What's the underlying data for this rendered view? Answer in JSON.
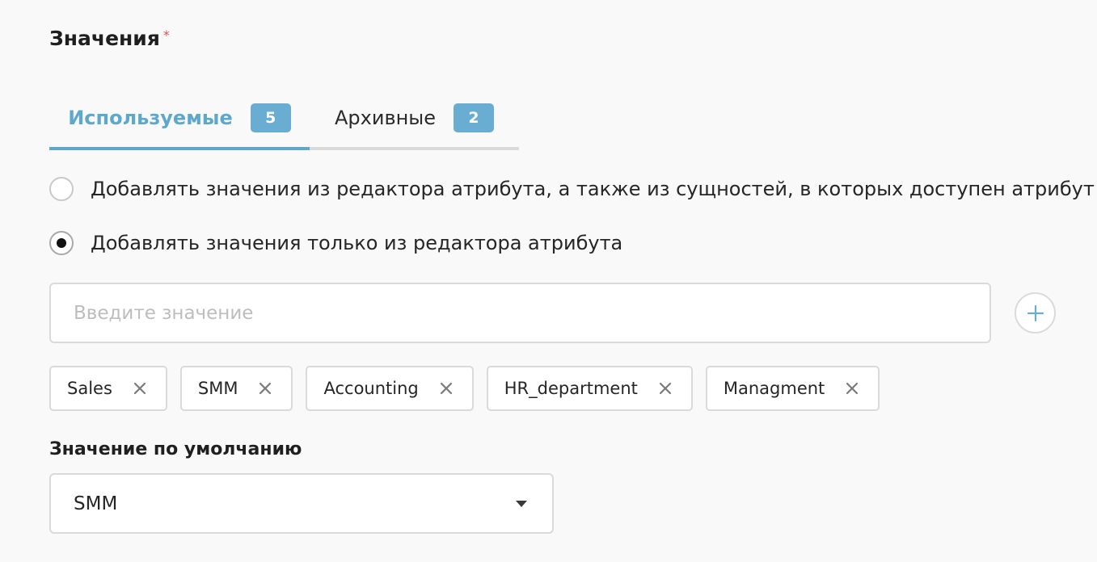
{
  "section": {
    "title": "Значения",
    "required_mark": "*"
  },
  "tabs": [
    {
      "label": "Используемые",
      "count": "5",
      "active": true
    },
    {
      "label": "Архивные",
      "count": "2",
      "active": false
    }
  ],
  "radios": [
    {
      "label": "Добавлять значения из редактора атрибута, а также из сущностей, в которых доступен атрибут",
      "checked": false
    },
    {
      "label": "Добавлять значения только из редактора атрибута",
      "checked": true
    }
  ],
  "value_input": {
    "value": "",
    "placeholder": "Введите значение"
  },
  "add_button": {
    "icon": "plus-icon"
  },
  "chips": [
    {
      "label": "Sales"
    },
    {
      "label": "SMM"
    },
    {
      "label": "Accounting"
    },
    {
      "label": "HR_department"
    },
    {
      "label": "Managment"
    }
  ],
  "chip_remove_icon": "close-icon",
  "default_value": {
    "label": "Значение по умолчанию",
    "selected": "SMM",
    "caret_icon": "caret-down-icon"
  },
  "colors": {
    "accent": "#5ea8cc",
    "badge_bg": "#6aadd2",
    "required": "#d9534f",
    "border": "#dadada",
    "page_bg": "#f9f9f9"
  }
}
